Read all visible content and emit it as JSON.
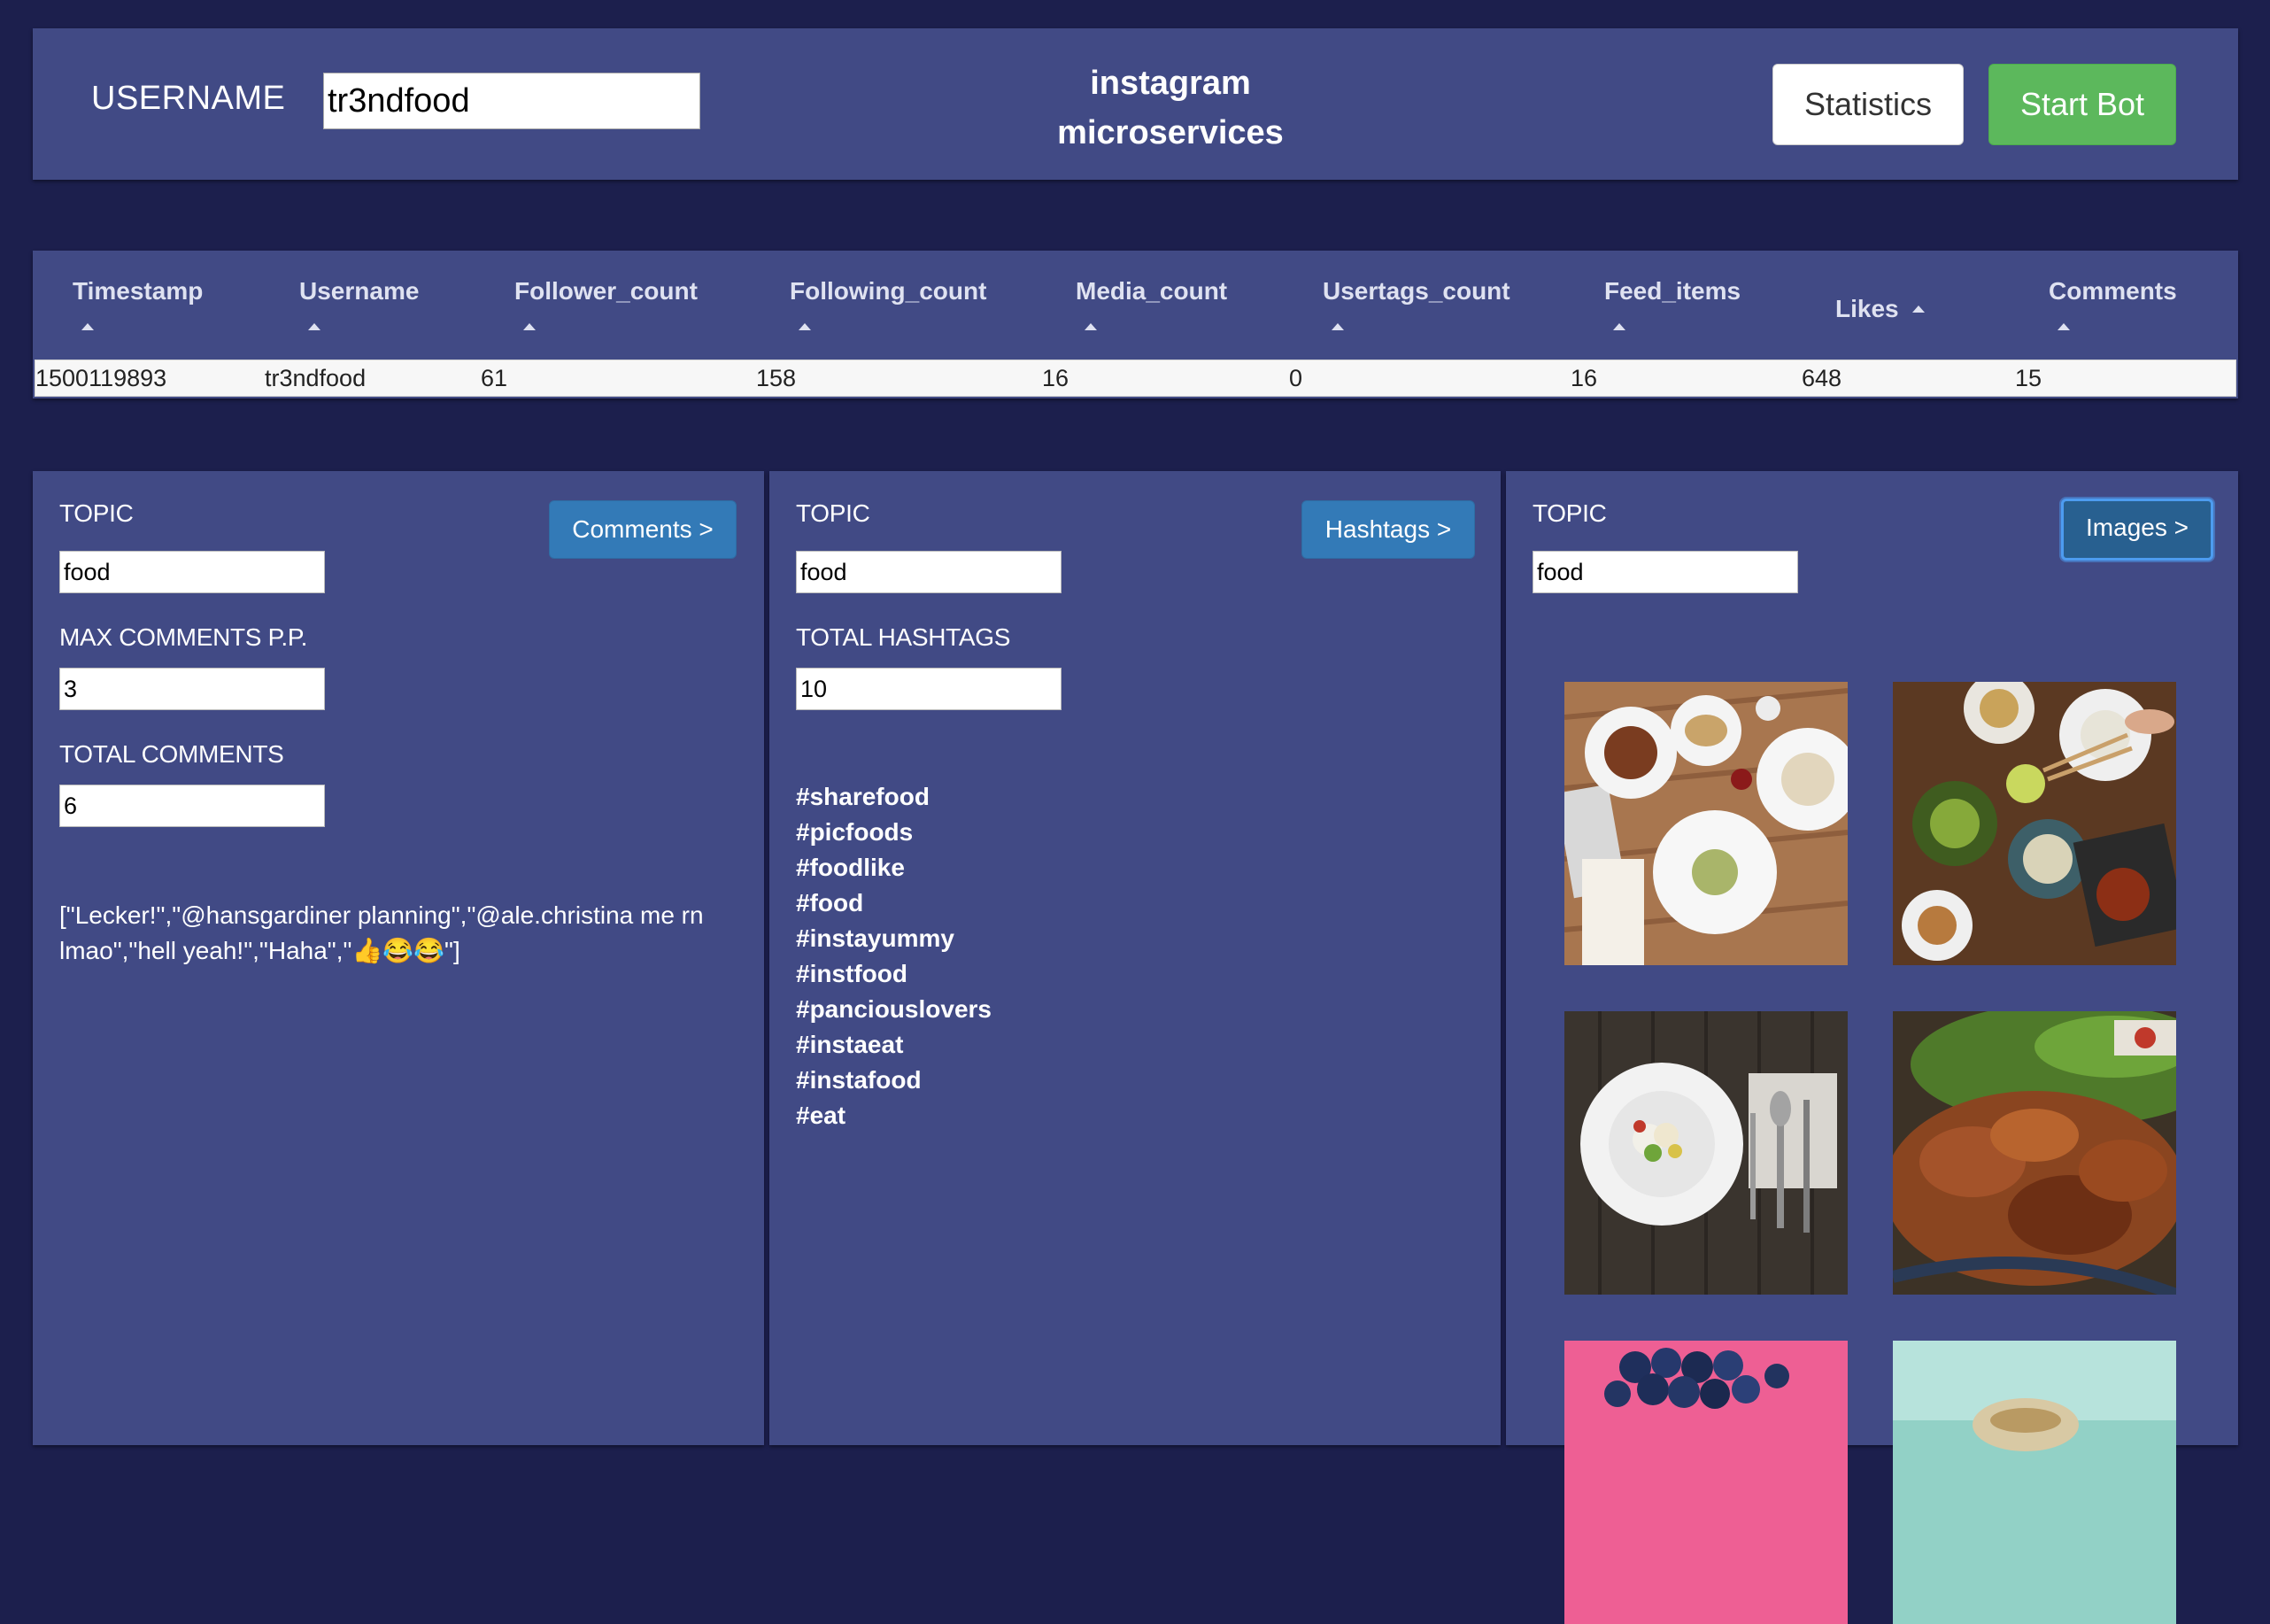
{
  "header": {
    "username_label": "USERNAME",
    "username_value": "tr3ndfood",
    "title_line1": "instagram",
    "title_line2": "microservices",
    "statistics_button": "Statistics",
    "start_bot_button": "Start Bot"
  },
  "table": {
    "columns": [
      "Timestamp",
      "Username",
      "Follower_count",
      "Following_count",
      "Media_count",
      "Usertags_count",
      "Feed_items",
      "Likes",
      "Comments"
    ],
    "row": [
      "1500119893",
      "tr3ndfood",
      "61",
      "158",
      "16",
      "0",
      "16",
      "648",
      "15"
    ]
  },
  "comments_panel": {
    "topic_label": "TOPIC",
    "topic_value": "food",
    "button": "Comments >",
    "max_label": "MAX COMMENTS P.P.",
    "max_value": "3",
    "total_label": "TOTAL COMMENTS",
    "total_value": "6",
    "output": "[\"Lecker!\",\"@hansgardiner planning\",\"@ale.christina me rn lmao\",\"hell yeah!\",\"Haha\",\"👍😂😂\"]"
  },
  "hashtags_panel": {
    "topic_label": "TOPIC",
    "topic_value": "food",
    "button": "Hashtags >",
    "total_label": "TOTAL HASHTAGS",
    "total_value": "10",
    "hashtags": [
      "#sharefood",
      "#picfoods",
      "#foodlike",
      "#food",
      "#instayummy",
      "#instfood",
      "#panciouslovers",
      "#instaeat",
      "#instafood",
      "#eat"
    ]
  },
  "images_panel": {
    "topic_label": "TOPIC",
    "topic_value": "food",
    "button": "Images >"
  },
  "colors": {
    "page_background": "#1c1f4d",
    "panel_background": "#414a85",
    "primary_button": "#337ab7",
    "success_button": "#5cb85c"
  }
}
